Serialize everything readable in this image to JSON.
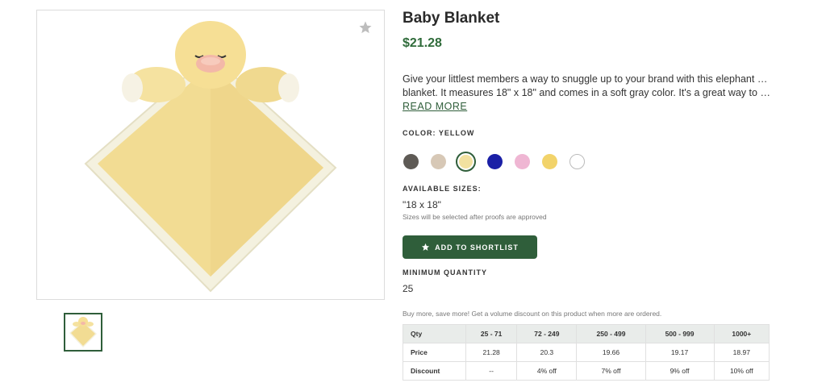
{
  "product": {
    "title": "Baby Blanket",
    "price": "$21.28",
    "description_line1": "Give your littlest members a way to snuggle up to your brand with this elephant baby",
    "description_line2": "blanket. It measures 18\" x 18\" and comes in a soft gray color. It's a great way to laun...",
    "read_more": "READ MORE"
  },
  "image": {
    "main_icon": "duck-blanket-image",
    "favorite_icon": "star-icon",
    "thumbnail_icon": "duck-blanket-thumbnail"
  },
  "color": {
    "label": "COLOR: YELLOW",
    "swatches": [
      {
        "name": "brown-gray",
        "hex": "#5e5a55"
      },
      {
        "name": "tan",
        "hex": "#d7c8b6"
      },
      {
        "name": "light-yellow",
        "hex": "#f2e1a0",
        "selected": true
      },
      {
        "name": "navy",
        "hex": "#1a1fa6"
      },
      {
        "name": "pink",
        "hex": "#efb6d3"
      },
      {
        "name": "yellow",
        "hex": "#f2d36a"
      },
      {
        "name": "white",
        "hex": "#ffffff"
      }
    ]
  },
  "sizes": {
    "label": "AVAILABLE SIZES:",
    "value": "\"18 x 18\"",
    "note": "Sizes will be selected after proofs are approved"
  },
  "shortlist_button": "ADD TO SHORTLIST",
  "minimum_quantity": {
    "label": "MINIMUM QUANTITY",
    "value": "25"
  },
  "volume": {
    "note": "Buy more, save more! Get a volume discount on this product when more are ordered.",
    "headers": [
      "Qty",
      "25 - 71",
      "72 - 249",
      "250 - 499",
      "500 - 999",
      "1000+"
    ],
    "rows": [
      {
        "label": "Price",
        "values": [
          "21.28",
          "20.3",
          "19.66",
          "19.17",
          "18.97"
        ]
      },
      {
        "label": "Discount",
        "values": [
          "--",
          "4% off",
          "7% off",
          "9% off",
          "10% off"
        ]
      }
    ]
  },
  "colors": {
    "accent": "#2f5e3a",
    "price": "#2f6b3a"
  }
}
